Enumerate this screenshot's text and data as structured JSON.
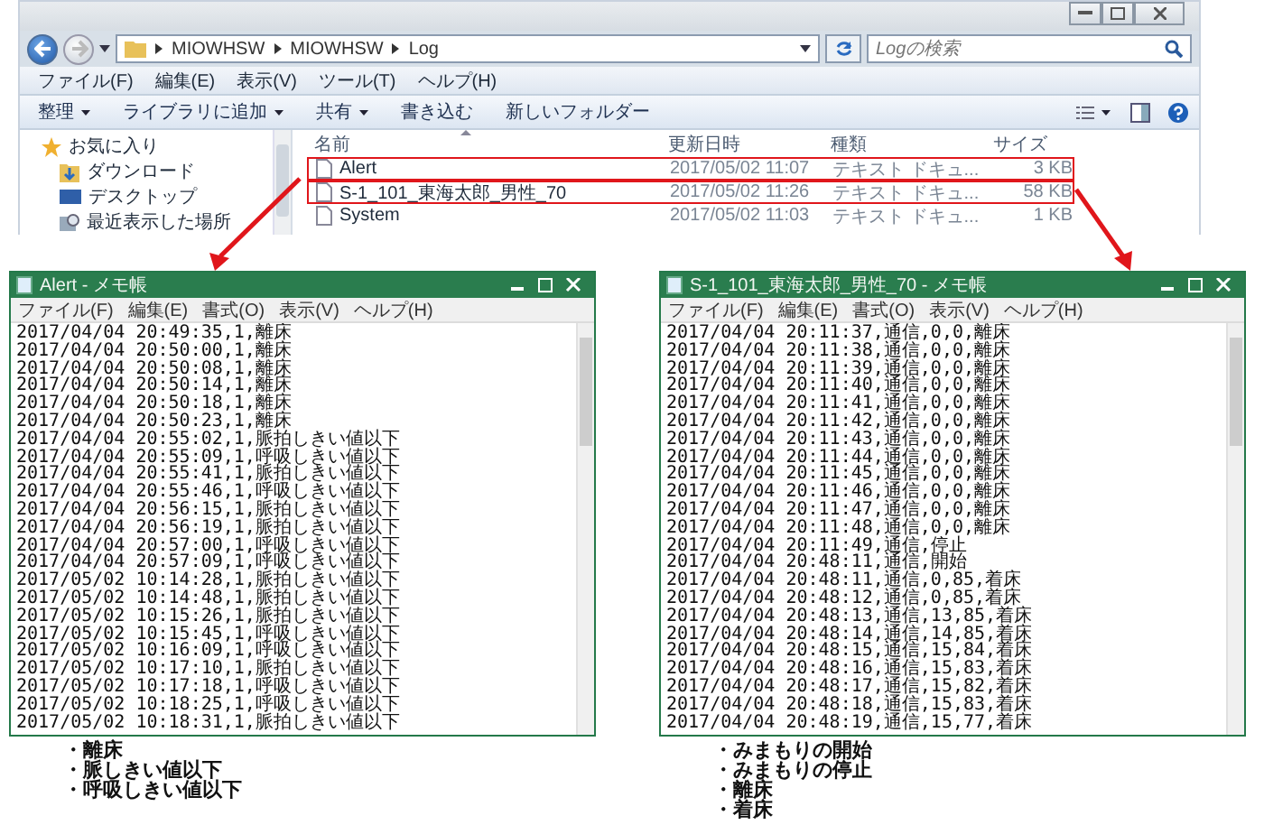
{
  "explorer": {
    "address": {
      "path": [
        "MIOWHSW",
        "MIOWHSW",
        "Log"
      ]
    },
    "search": {
      "placeholder": "Logの検索"
    },
    "menu": [
      "ファイル(F)",
      "編集(E)",
      "表示(V)",
      "ツール(T)",
      "ヘルプ(H)"
    ],
    "toolbar": [
      {
        "label": "整理",
        "dropdown": true
      },
      {
        "label": "ライブラリに追加",
        "dropdown": true
      },
      {
        "label": "共有",
        "dropdown": true
      },
      {
        "label": "書き込む",
        "dropdown": false
      },
      {
        "label": "新しいフォルダー",
        "dropdown": false
      }
    ],
    "sidebar": {
      "items": [
        {
          "label": "お気に入り",
          "kind": "star"
        },
        {
          "label": "ダウンロード",
          "kind": "download"
        },
        {
          "label": "デスクトップ",
          "kind": "desktop"
        },
        {
          "label": "最近表示した場所",
          "kind": "recent"
        }
      ]
    },
    "file_list": {
      "columns": [
        "名前",
        "更新日時",
        "種類",
        "サイズ"
      ],
      "rows": [
        {
          "name": "Alert",
          "modified": "2017/05/02 11:07",
          "type": "テキスト ドキュ...",
          "size": "3 KB",
          "highlighted": true
        },
        {
          "name": "S-1_101_東海太郎_男性_70",
          "modified": "2017/05/02 11:26",
          "type": "テキスト ドキュ...",
          "size": "58 KB",
          "highlighted": true
        },
        {
          "name": "System",
          "modified": "2017/05/02 11:03",
          "type": "テキスト ドキュ...",
          "size": "1 KB",
          "highlighted": false
        }
      ]
    }
  },
  "notepads": [
    {
      "title": "Alert - メモ帳",
      "menu": [
        "ファイル(F)",
        "編集(E)",
        "書式(O)",
        "表示(V)",
        "ヘルプ(H)"
      ],
      "lines": [
        "2017/04/04 20:49:35,1,離床",
        "2017/04/04 20:50:00,1,離床",
        "2017/04/04 20:50:08,1,離床",
        "2017/04/04 20:50:14,1,離床",
        "2017/04/04 20:50:18,1,離床",
        "2017/04/04 20:50:23,1,離床",
        "2017/04/04 20:55:02,1,脈拍しきい値以下",
        "2017/04/04 20:55:09,1,呼吸しきい値以下",
        "2017/04/04 20:55:41,1,脈拍しきい値以下",
        "2017/04/04 20:55:46,1,呼吸しきい値以下",
        "2017/04/04 20:56:15,1,脈拍しきい値以下",
        "2017/04/04 20:56:19,1,脈拍しきい値以下",
        "2017/04/04 20:57:00,1,呼吸しきい値以下",
        "2017/04/04 20:57:09,1,呼吸しきい値以下",
        "2017/05/02 10:14:28,1,脈拍しきい値以下",
        "2017/05/02 10:14:48,1,脈拍しきい値以下",
        "2017/05/02 10:15:26,1,脈拍しきい値以下",
        "2017/05/02 10:15:45,1,呼吸しきい値以下",
        "2017/05/02 10:16:09,1,呼吸しきい値以下",
        "2017/05/02 10:17:10,1,脈拍しきい値以下",
        "2017/05/02 10:17:18,1,呼吸しきい値以下",
        "2017/05/02 10:18:25,1,呼吸しきい値以下",
        "2017/05/02 10:18:31,1,脈拍しきい値以下"
      ],
      "bullets": [
        "・離床",
        "・脈しきい値以下",
        "・呼吸しきい値以下"
      ]
    },
    {
      "title": "S-1_101_東海太郎_男性_70 - メモ帳",
      "menu": [
        "ファイル(F)",
        "編集(E)",
        "書式(O)",
        "表示(V)",
        "ヘルプ(H)"
      ],
      "lines": [
        "2017/04/04 20:11:37,通信,0,0,離床",
        "2017/04/04 20:11:38,通信,0,0,離床",
        "2017/04/04 20:11:39,通信,0,0,離床",
        "2017/04/04 20:11:40,通信,0,0,離床",
        "2017/04/04 20:11:41,通信,0,0,離床",
        "2017/04/04 20:11:42,通信,0,0,離床",
        "2017/04/04 20:11:43,通信,0,0,離床",
        "2017/04/04 20:11:44,通信,0,0,離床",
        "2017/04/04 20:11:45,通信,0,0,離床",
        "2017/04/04 20:11:46,通信,0,0,離床",
        "2017/04/04 20:11:47,通信,0,0,離床",
        "2017/04/04 20:11:48,通信,0,0,離床",
        "2017/04/04 20:11:49,通信,停止",
        "2017/04/04 20:48:11,通信,開始",
        "2017/04/04 20:48:11,通信,0,85,着床",
        "2017/04/04 20:48:12,通信,0,85,着床",
        "2017/04/04 20:48:13,通信,13,85,着床",
        "2017/04/04 20:48:14,通信,14,85,着床",
        "2017/04/04 20:48:15,通信,15,84,着床",
        "2017/04/04 20:48:16,通信,15,83,着床",
        "2017/04/04 20:48:17,通信,15,82,着床",
        "2017/04/04 20:48:18,通信,15,83,着床",
        "2017/04/04 20:48:19,通信,15,77,着床"
      ],
      "bullets": [
        "・みまもりの開始",
        "・みまもりの停止",
        "・離床",
        "・着床"
      ]
    }
  ]
}
